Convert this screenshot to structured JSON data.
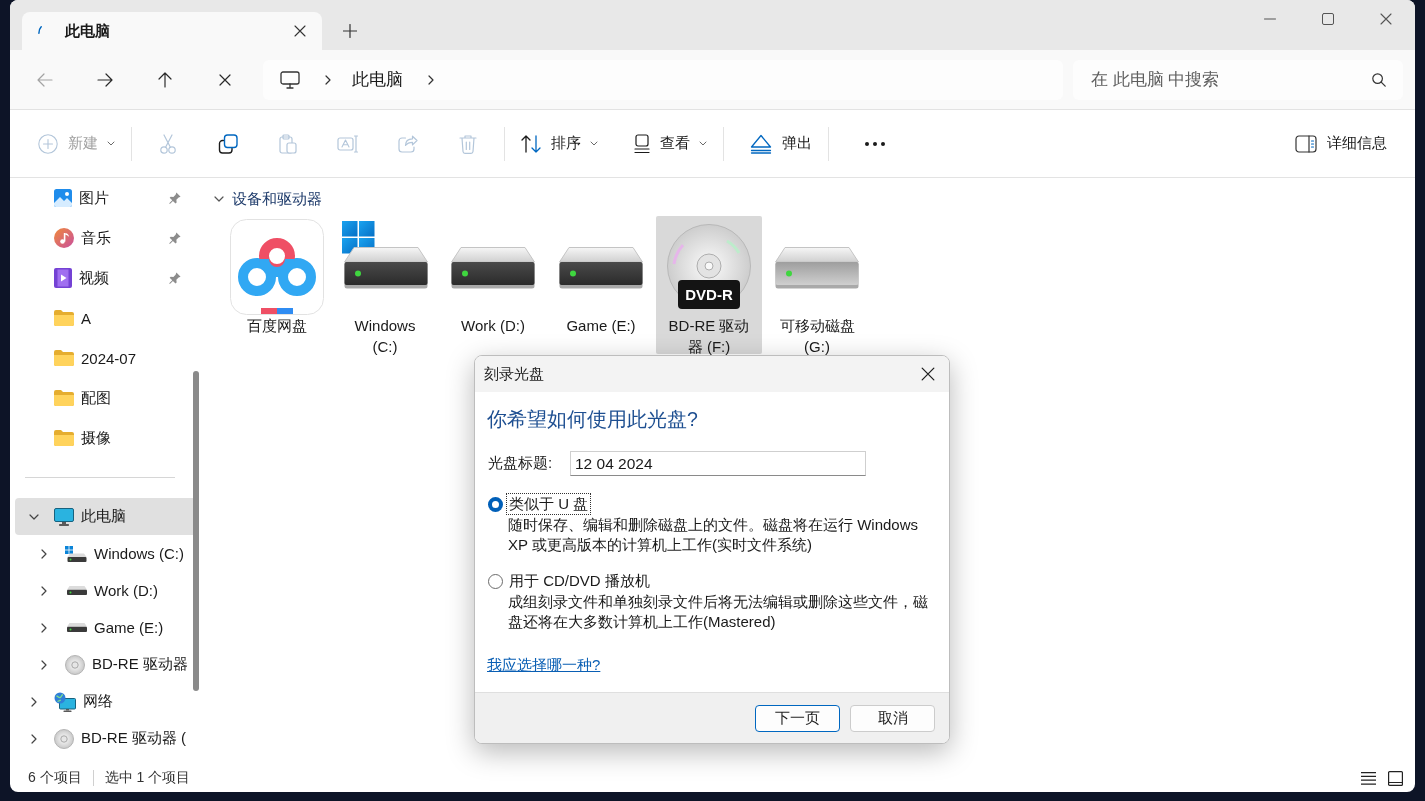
{
  "window": {
    "tabs": [
      {
        "title": "此电脑",
        "selected": true
      }
    ]
  },
  "navigation": {
    "buttons": [
      {
        "kind": "back",
        "disabled": true
      },
      {
        "kind": "forward",
        "disabled": false
      },
      {
        "kind": "up",
        "disabled": false
      },
      {
        "kind": "stop",
        "disabled": false
      }
    ],
    "breadcrumb": [
      "此电脑"
    ],
    "search": {
      "placeholder": "在 此电脑 中搜索"
    }
  },
  "toolbar": {
    "items": [
      {
        "kind": "new",
        "label": "新建",
        "menu": true,
        "disabled": true
      },
      {
        "kind": "separator"
      },
      {
        "kind": "cut",
        "disabled": true
      },
      {
        "kind": "copy",
        "disabled": false
      },
      {
        "kind": "paste",
        "disabled": true
      },
      {
        "kind": "rename",
        "disabled": true
      },
      {
        "kind": "share",
        "disabled": true
      },
      {
        "kind": "delete",
        "disabled": true
      },
      {
        "kind": "separator"
      },
      {
        "kind": "sort",
        "label": "排序",
        "menu": true,
        "disabled": false
      },
      {
        "kind": "view",
        "label": "查看",
        "menu": true,
        "disabled": false
      },
      {
        "kind": "separator"
      },
      {
        "kind": "eject",
        "label": "弹出",
        "disabled": false
      },
      {
        "kind": "separator"
      },
      {
        "kind": "more",
        "disabled": false
      }
    ],
    "details": {
      "label": "详细信息"
    }
  },
  "sidebar": {
    "quick_access": [
      {
        "kind": "pictures",
        "label": "图片",
        "pinned": true,
        "selected": false
      },
      {
        "kind": "music",
        "label": "音乐",
        "pinned": true,
        "selected": false
      },
      {
        "kind": "videos",
        "label": "视频",
        "pinned": true,
        "selected": false
      },
      {
        "kind": "folder",
        "label": "A",
        "pinned": false,
        "selected": false
      },
      {
        "kind": "folder",
        "label": "2024-07",
        "pinned": false,
        "selected": false
      },
      {
        "kind": "folder",
        "label": "配图",
        "pinned": false,
        "selected": false
      },
      {
        "kind": "folder",
        "label": "摄像",
        "pinned": false,
        "selected": false
      }
    ],
    "tree": [
      {
        "kind": "pc",
        "label": "此电脑",
        "expanded": true,
        "selected": true,
        "children": [
          {
            "kind": "system-drive",
            "label": "Windows (C:)",
            "expanded": false,
            "selected": false
          },
          {
            "kind": "drive",
            "label": "Work (D:)",
            "expanded": false,
            "selected": false
          },
          {
            "kind": "drive",
            "label": "Game (E:)",
            "expanded": false,
            "selected": false
          },
          {
            "kind": "disc",
            "label": "BD-RE 驱动器",
            "expanded": false,
            "selected": false
          }
        ]
      },
      {
        "kind": "network",
        "label": "网络",
        "expanded": false,
        "selected": false
      },
      {
        "kind": "disc",
        "label": "BD-RE 驱动器 (",
        "expanded": false,
        "selected": false
      }
    ]
  },
  "content": {
    "group": {
      "title": "设备和驱动器",
      "expanded": true
    },
    "drives": [
      {
        "kind": "app",
        "label": "百度网盘",
        "selected": false
      },
      {
        "kind": "system-drive",
        "label": "Windows (C:)",
        "selected": false
      },
      {
        "kind": "drive",
        "label": "Work (D:)",
        "selected": false
      },
      {
        "kind": "drive",
        "label": "Game (E:)",
        "selected": false
      },
      {
        "kind": "disc",
        "label": "BD-RE 驱动器 (F:)",
        "disc_type": "DVD-R",
        "selected": true
      },
      {
        "kind": "removable",
        "label": "可移动磁盘 (G:)",
        "selected": false
      }
    ]
  },
  "status_bar": {
    "item_count": "6 个项目",
    "selection": "选中 1 个项目",
    "views": [
      {
        "kind": "details"
      },
      {
        "kind": "tiles"
      }
    ]
  },
  "dialog": {
    "title": "刻录光盘",
    "heading": "你希望如何使用此光盘?",
    "disc_title": {
      "label": "光盘标题:",
      "value": "12 04 2024"
    },
    "options": [
      {
        "label": "类似于 U 盘",
        "description": "随时保存、编辑和删除磁盘上的文件。磁盘将在运行 Windows XP 或更高版本的计算机上工作(实时文件系统)",
        "selected": true,
        "focused": true
      },
      {
        "label": "用于 CD/DVD 播放机",
        "description": "成组刻录文件和单独刻录文件后将无法编辑或删除这些文件，磁盘还将在大多数计算机上工作(Mastered)",
        "selected": false,
        "focused": false
      }
    ],
    "help_link": "我应选择哪一种?",
    "buttons": [
      {
        "label": "下一页",
        "default": true
      },
      {
        "label": "取消",
        "default": false
      }
    ]
  }
}
